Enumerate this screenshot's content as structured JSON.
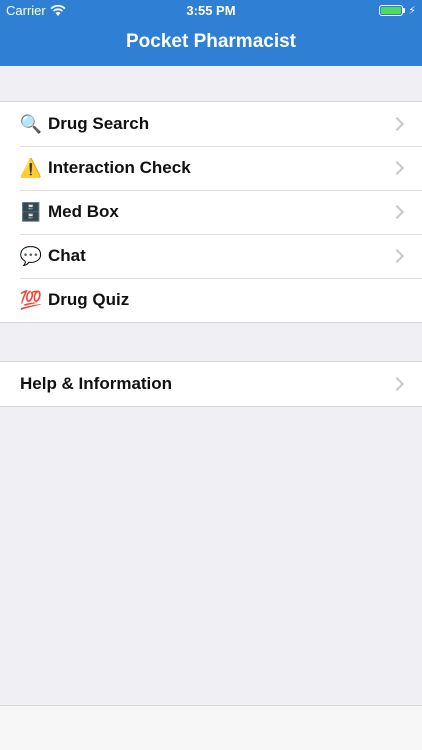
{
  "status_bar": {
    "carrier": "Carrier",
    "time": "3:55 PM",
    "battery_level": 1.0,
    "battery_color": "#4cd964"
  },
  "nav": {
    "title": "Pocket Pharmacist",
    "color": "#2f7fd4"
  },
  "menu": {
    "items": [
      {
        "label": "Drug Search",
        "icon": "magnifying-glass-icon",
        "glyph": "🔍"
      },
      {
        "label": "Interaction Check",
        "icon": "warning-icon",
        "glyph": "⚠️"
      },
      {
        "label": "Med Box",
        "icon": "file-cabinet-icon",
        "glyph": "🗄️"
      },
      {
        "label": "Chat",
        "icon": "speech-bubble-icon",
        "glyph": "💬"
      },
      {
        "label": "Drug Quiz",
        "icon": "hundred-points-icon",
        "glyph": "💯"
      }
    ]
  },
  "help": {
    "label": "Help & Information"
  }
}
